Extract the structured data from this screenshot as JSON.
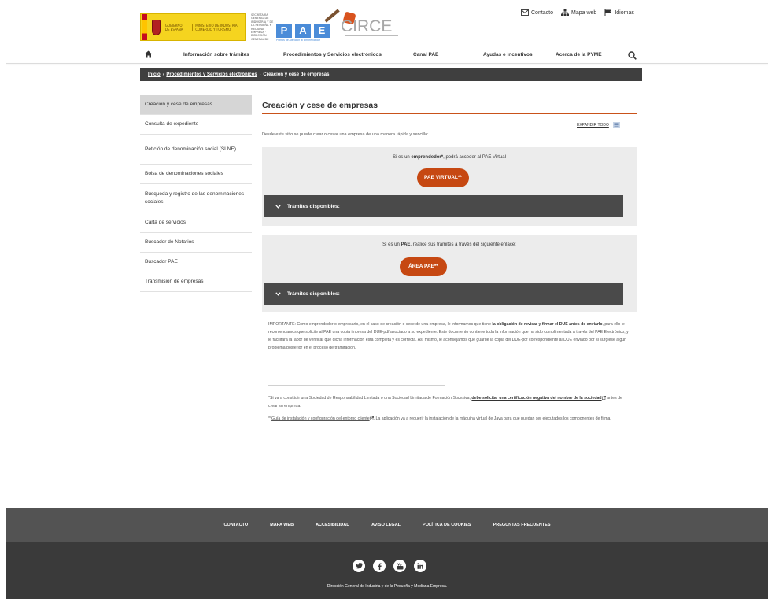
{
  "header": {
    "gov_logo_line1": "GOBIERNO DE ESPAÑA",
    "gov_logo_line2": "MINISTERIO DE INDUSTRIA, COMERCIO Y TURISMO",
    "ministry_text": "SECRETARÍA GENERAL DE INDUSTRIA Y DE LA PEQUEÑA Y MEDIANA EMPRESA · DIRECCIÓN GENERAL DE INDUSTRIA Y DE LA PEQUEÑA Y MEDIANA EMPRESA",
    "pae_letters": [
      "P",
      "A",
      "E"
    ],
    "pae_tagline": "Puntos de Atención al Emprendedor",
    "circe_logo": "CIRCE",
    "util_links": [
      "Contacto",
      "Mapa web",
      "Idiomas"
    ]
  },
  "nav": {
    "items": [
      "Información sobre trámites",
      "Procedimientos y Servicios electrónicos",
      "Canal PAE",
      "Ayudas e incentivos",
      "Acerca de la PYME"
    ]
  },
  "breadcrumb": {
    "items": [
      "Inicio",
      "Procedimientos y Servicios electrónicos",
      "Creación y cese de empresas"
    ]
  },
  "sidebar": {
    "items": [
      "Creación y cese de empresas",
      "Consulta de expediente",
      "Petición de denominación social (SLNE)",
      "Bolsa de denominaciones sociales",
      "Búsqueda y registro de las denominaciones sociales",
      "Carta de servicios",
      "Buscador de Notarios",
      "Buscador PAE",
      "Transmisión de empresas"
    ]
  },
  "main": {
    "title": "Creación y cese de empresas",
    "expand_all": "EXPANDIR TODO",
    "intro": "Desde este sitio se puede crear o cesar una empresa de una manera rápida y sencilla:",
    "panel1": {
      "text_pre": "Si es un ",
      "text_bold": "emprendedor*",
      "text_post": ", podrá acceder al PAE Virtual",
      "button": "PAE VIRTUAL**",
      "tramites": "Trámites disponibles:"
    },
    "panel2": {
      "text_pre": "Si es un ",
      "text_bold": "PAE",
      "text_post": ", realice sus trámites a través del siguiente enlace:",
      "button": "ÁREA PAE**",
      "tramites": "Trámites disponibles:"
    },
    "important": {
      "p1": "IMPORTANTE: Como emprendedor o empresario, en el caso de creación o cese de una empresa, le informamos que tiene ",
      "b1": "la obligación de revisar y firmar el DUE antes de enviarlo",
      "p2": ", para ello le recomendamos que solicite al PAE una copia impresa del DUE-pdf asociado a su expediente. Este documento contiene toda la información que ha sido cumplimentada a través del PAE Electrónico, y le facilitará la labor de verificar que dicha información está completa y es correcta. Así mismo, le aconsejamos que guarde la copia del DUE-pdf correspondiente al DUE enviado por si surgiese algún problema posterior en el proceso de tramitación."
    },
    "note1": {
      "pre": "*Si va a constituir una Sociedad de Responsabilidad Limitada o una Sociedad Limitada de Formación Sucesiva, ",
      "link": "debe solicitar una certificación negativa del nombre de la sociedad",
      "post": " antes de crear su empresa."
    },
    "note2": {
      "pre": "**",
      "link": "Guía de instalación y configuración del entorno cliente",
      "post": ". La aplicación va a requerir la instalación de la máquina virtual de Java para que puedan ser ejecutados los componentes de firma."
    }
  },
  "footer": {
    "links": [
      "CONTACTO",
      "MAPA WEB",
      "ACCESIBILIDAD",
      "AVISO LEGAL",
      "POLÍTICA DE COOKIES",
      "PREGUNTAS FRECUENTES"
    ],
    "social": [
      "twitter-icon",
      "facebook-icon",
      "youtube-icon",
      "linkedin-icon"
    ],
    "org": "Dirección General de Industria y de la Pequeña y Mediana Empresa."
  },
  "colors": {
    "accent": "#c64812",
    "dark_bar": "#4a4a4a",
    "breadcrumb_bg": "#3f3f3f"
  }
}
